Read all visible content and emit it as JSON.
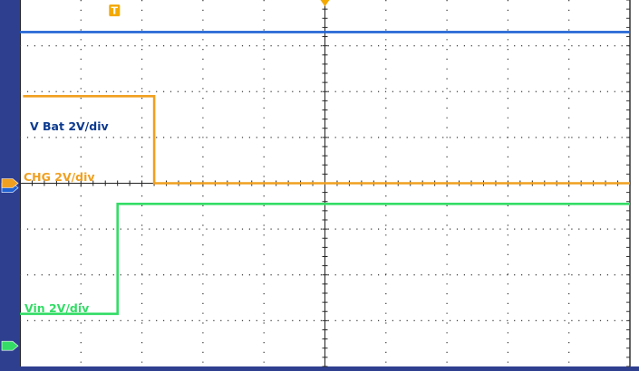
{
  "colors": {
    "frame": "#2f3f90",
    "grid": "#3a3a3a",
    "vbat": "#1f62d4",
    "chg": "#f0a020",
    "vin": "#33dd66",
    "trigger": "#f3a900"
  },
  "markers": {
    "trigger_label": "T"
  },
  "chart_data": {
    "type": "line",
    "title": "",
    "grid": true,
    "divisions": {
      "x": 10,
      "y": 8
    },
    "x_unit": "div",
    "y_unit": "div",
    "xlim": [
      0,
      10
    ],
    "ylim": [
      0,
      8
    ],
    "series": [
      {
        "name": "V Bat 2V/div",
        "color_key": "vbat",
        "x": [
          0,
          10
        ],
        "y": [
          7.3,
          7.3
        ]
      },
      {
        "name": "CHG 2V/div",
        "color_key": "chg",
        "x": [
          0.05,
          2.2,
          2.2,
          10
        ],
        "y": [
          5.9,
          5.9,
          4.0,
          4.0
        ]
      },
      {
        "name": "Vin  2V/div",
        "color_key": "vin",
        "x": [
          0,
          1.6,
          1.6,
          10
        ],
        "y": [
          1.15,
          1.15,
          3.55,
          3.55
        ]
      }
    ]
  }
}
